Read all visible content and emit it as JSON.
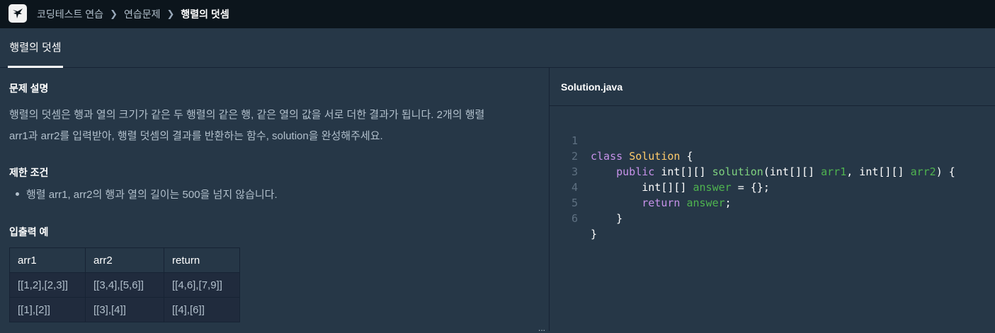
{
  "topbar": {
    "breadcrumb": [
      "코딩테스트 연습",
      "연습문제"
    ],
    "current": "행렬의 덧셈"
  },
  "tab": {
    "label": "행렬의 덧셈"
  },
  "problem": {
    "desc_heading": "문제 설명",
    "desc_line1": "행렬의 덧셈은 행과 열의 크기가 같은 두 행렬의 같은 행, 같은 열의 값을 서로 더한 결과가 됩니다. 2개의 행렬",
    "desc_line2": "arr1과 arr2를 입력받아, 행렬 덧셈의 결과를 반환하는 함수, solution을 완성해주세요.",
    "limit_heading": "제한 조건",
    "limit_item": "행렬 arr1, arr2의 행과 열의 길이는 500을 넘지 않습니다.",
    "io_heading": "입출력 예",
    "io_table": {
      "headers": [
        "arr1",
        "arr2",
        "return"
      ],
      "rows": [
        [
          "[[1,2],[2,3]]",
          "[[3,4],[5,6]]",
          "[[4,6],[7,9]]"
        ],
        [
          "[[1],[2]]",
          "[[3],[4]]",
          "[[4],[6]]"
        ]
      ]
    }
  },
  "editor": {
    "filename": "Solution.java",
    "line_numbers": [
      "1",
      "2",
      "3",
      "4",
      "5",
      "6"
    ],
    "code": {
      "l1_kw": "class",
      "l1_cls": "Solution",
      "l1_rest": " {",
      "l2_kw": "public",
      "l2_type": " int[][] ",
      "l2_fn": "solution",
      "l2_p1": "(int[][] ",
      "l2_arr1": "arr1",
      "l2_p2": ", int[][] ",
      "l2_arr2": "arr2",
      "l2_p3": ") {",
      "l3_type": "int[][] ",
      "l3_var": "answer",
      "l3_rest": " = {};",
      "l4_kw": "return",
      "l4_sp": " ",
      "l4_var": "answer",
      "l4_rest": ";",
      "l5": "}",
      "l6": "}"
    }
  },
  "ellipsis": "..."
}
